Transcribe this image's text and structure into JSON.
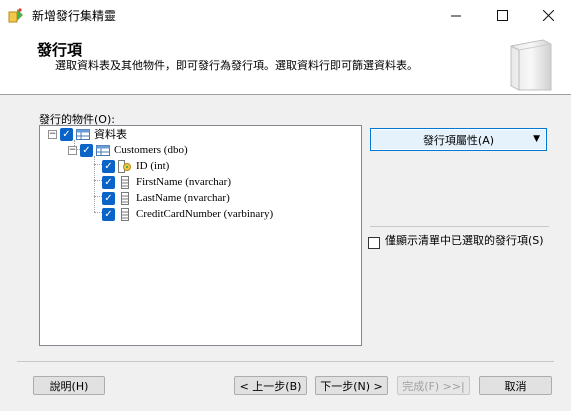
{
  "window": {
    "title": "新增發行集精靈",
    "minimize_glyph": "—",
    "maximize_glyph": "☐",
    "close_glyph": "✕",
    "icon": "wizard-icon"
  },
  "header": {
    "title": "發行項",
    "subtitle": "選取資料表及其他物件，即可發行為發行項。選取資料行即可篩選資料表。"
  },
  "objects": {
    "label": "發行的物件(O):",
    "tree": [
      {
        "label": "資料表",
        "checked": true,
        "expander": "−",
        "icon": "tables-folder-icon"
      },
      {
        "label": "Customers (dbo)",
        "checked": true,
        "expander": "−",
        "icon": "table-icon"
      },
      {
        "label": "ID (int)",
        "checked": true,
        "icon": "primary-key-column-icon"
      },
      {
        "label": "FirstName (nvarchar)",
        "checked": true,
        "icon": "column-icon"
      },
      {
        "label": "LastName (nvarchar)",
        "checked": true,
        "icon": "column-icon"
      },
      {
        "label": "CreditCardNumber (varbinary)",
        "checked": true,
        "icon": "column-icon"
      }
    ]
  },
  "side": {
    "properties_button": "發行項屬性(A)",
    "properties_arrow": "▼",
    "only_selected_label": "僅顯示清單中已選取的發行項(S)",
    "only_selected_checked": false
  },
  "footer": {
    "help": "說明(H)",
    "back": "< 上一步(B)",
    "next": "下一步(N) >",
    "finish": "完成(F) >>|",
    "cancel": "取消"
  },
  "colors": {
    "checkbox_blue": "#0a64c8",
    "focus_border": "#0078d7"
  }
}
